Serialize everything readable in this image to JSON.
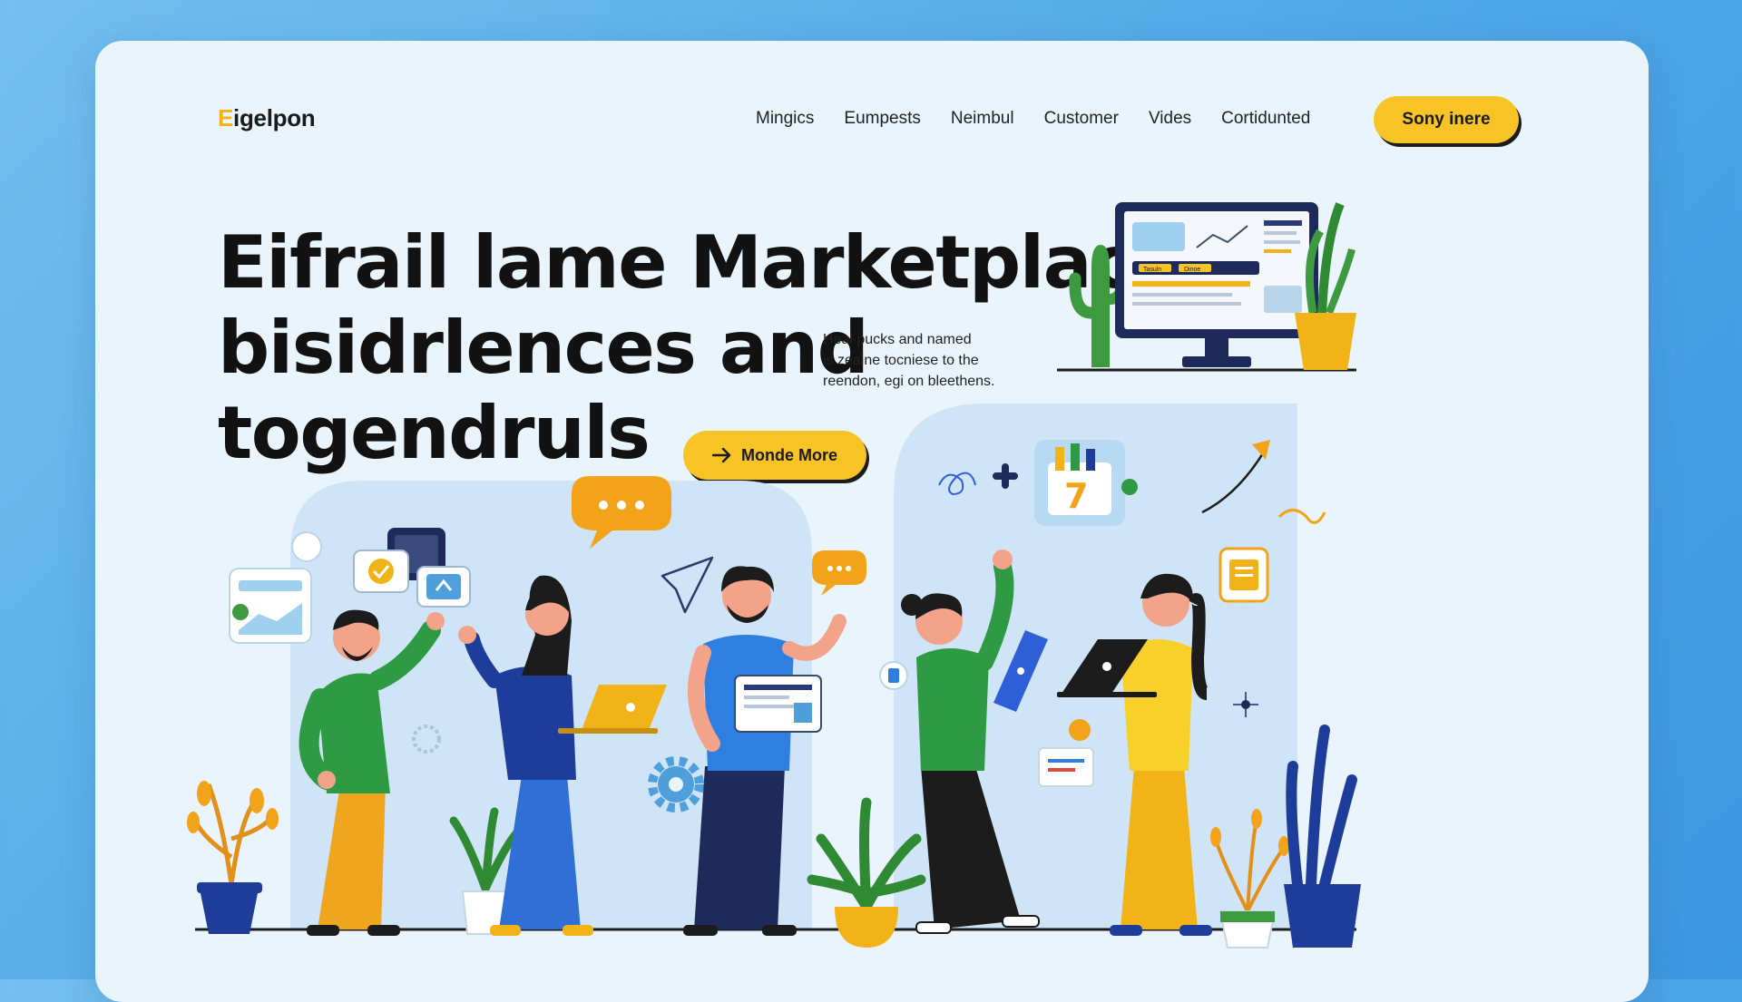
{
  "brand": {
    "logo_first": "E",
    "logo_rest": "igelpon"
  },
  "nav": {
    "items": [
      {
        "label": "Mingics"
      },
      {
        "label": "Eumpests"
      },
      {
        "label": "Neimbul"
      },
      {
        "label": "Customer"
      },
      {
        "label": "Vides"
      },
      {
        "label": "Cortidunted"
      }
    ],
    "cta_label": "Sony inere"
  },
  "hero": {
    "headline_lines": [
      "Eifrail lame Marketplaces",
      "bisidrlences and",
      "togendruls"
    ],
    "description_lines": [
      "Heal pucks and named",
      "is zeaine tocniese to the",
      "reendon, egi on bleethens."
    ],
    "cta_label": "Monde More",
    "cta_icon": "arrow-right-icon"
  },
  "illustration": {
    "calendar_number": "7",
    "monitor_tags": [
      "Tasuln",
      "Dinoe"
    ]
  },
  "colors": {
    "accent_yellow": "#f7c325",
    "background_blue": "#4fa6e6",
    "card_background": "#eaf4fd",
    "text_dark": "#121212"
  }
}
